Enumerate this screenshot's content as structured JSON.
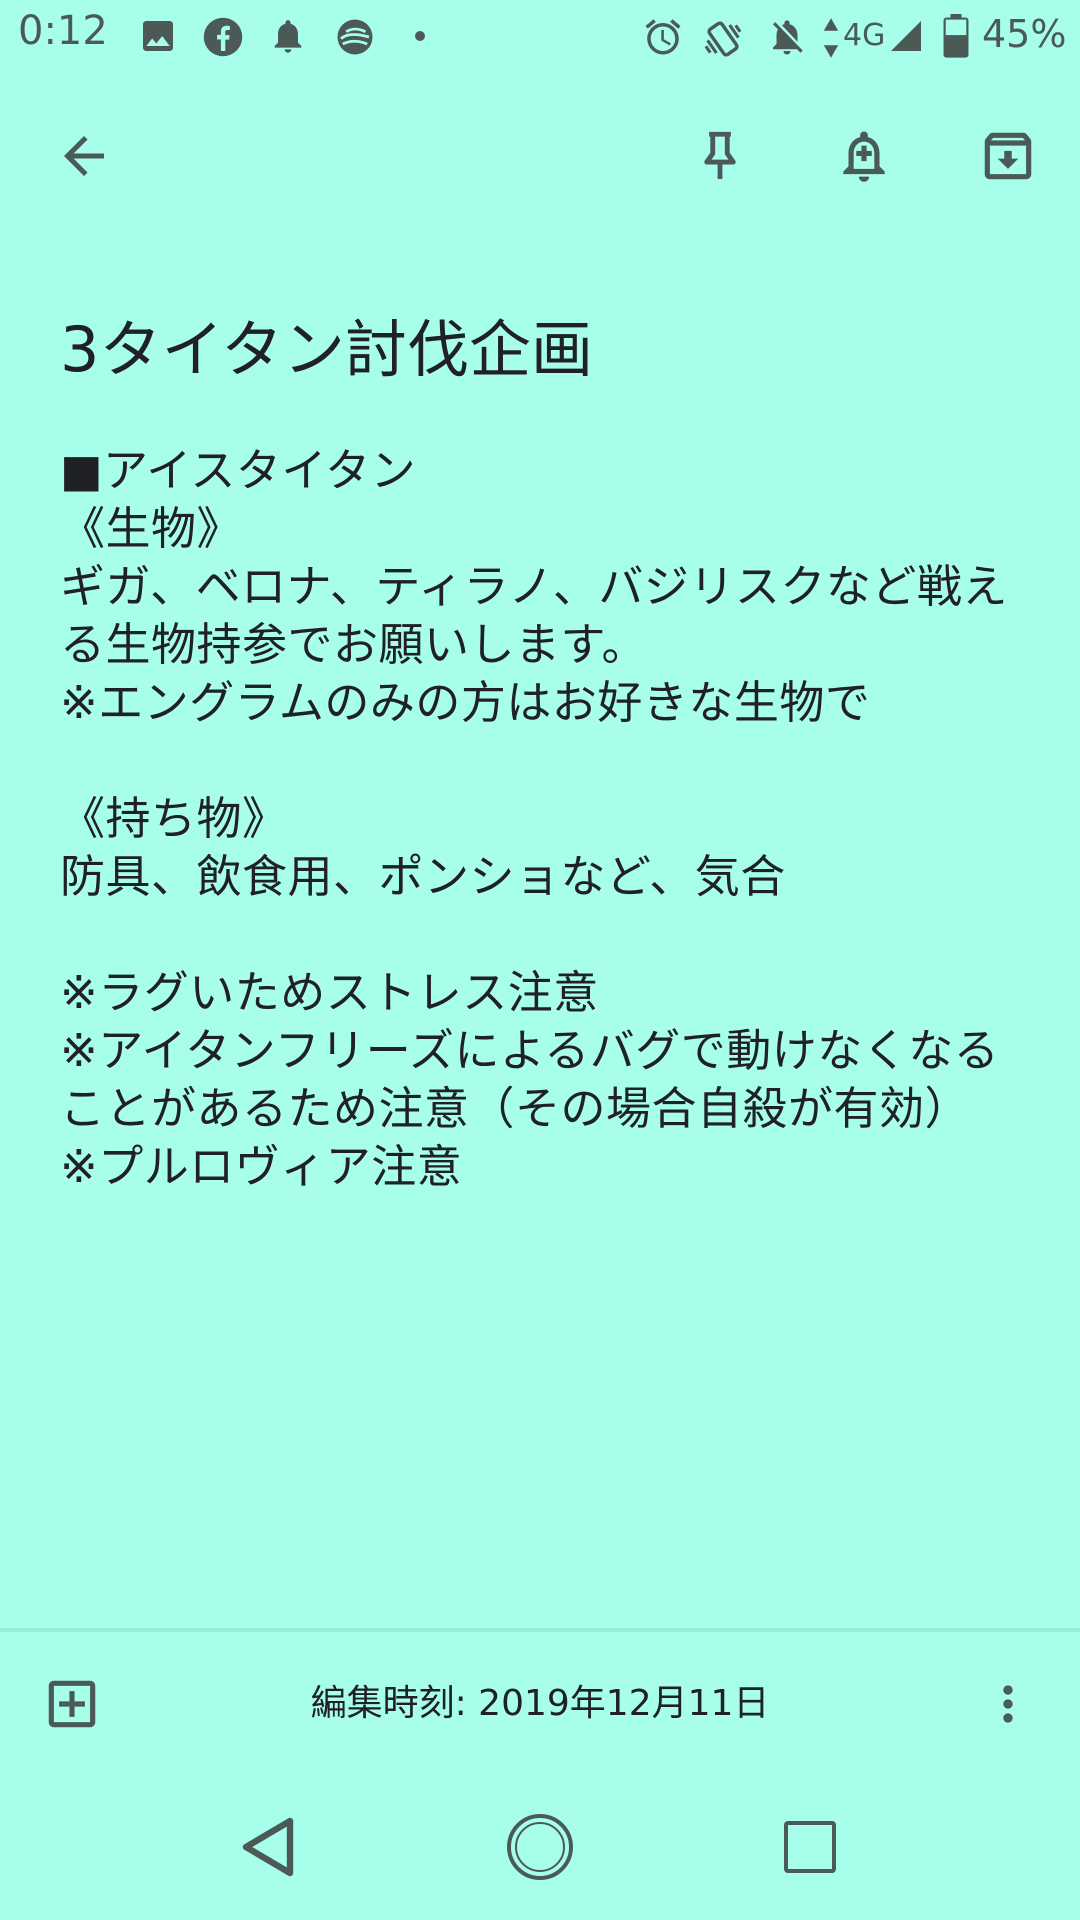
{
  "status_bar": {
    "time": "0:12",
    "network": "4G",
    "battery": "45%",
    "icons": [
      "image-icon",
      "facebook-icon",
      "notification-bell-icon",
      "app-icon",
      "dot-icon",
      "alarm-icon",
      "vibrate-icon",
      "mute-icon",
      "signal-icon",
      "battery-icon"
    ]
  },
  "toolbar": {
    "icons": [
      "back-arrow-icon",
      "pin-icon",
      "reminder-bell-icon",
      "archive-icon"
    ]
  },
  "note": {
    "title": "3タイタン討伐企画",
    "body": "■アイスタイタン\n《生物》\nギガ、ベロナ、ティラノ、バジリスクなど戦える生物持参でお願いします。\n※エングラムのみの方はお好きな生物で\n\n《持ち物》\n防具、飲食用、ポンショなど、気合\n\n※ラグいためストレス注意\n※アイタンフリーズによるバグで動けなくなることがあるため注意（その場合自殺が有効）\n※プルロヴィア注意"
  },
  "bottom_bar": {
    "edited_time": "編集時刻: 2019年12月11日",
    "icons": [
      "add-box-icon",
      "more-vert-icon"
    ]
  },
  "nav_bar": {
    "icons": [
      "nav-back-icon",
      "nav-home-icon",
      "nav-recents-icon"
    ]
  },
  "colors": {
    "background": "#a7ffeb",
    "icon": "#4b5a57",
    "text": "#202124"
  }
}
